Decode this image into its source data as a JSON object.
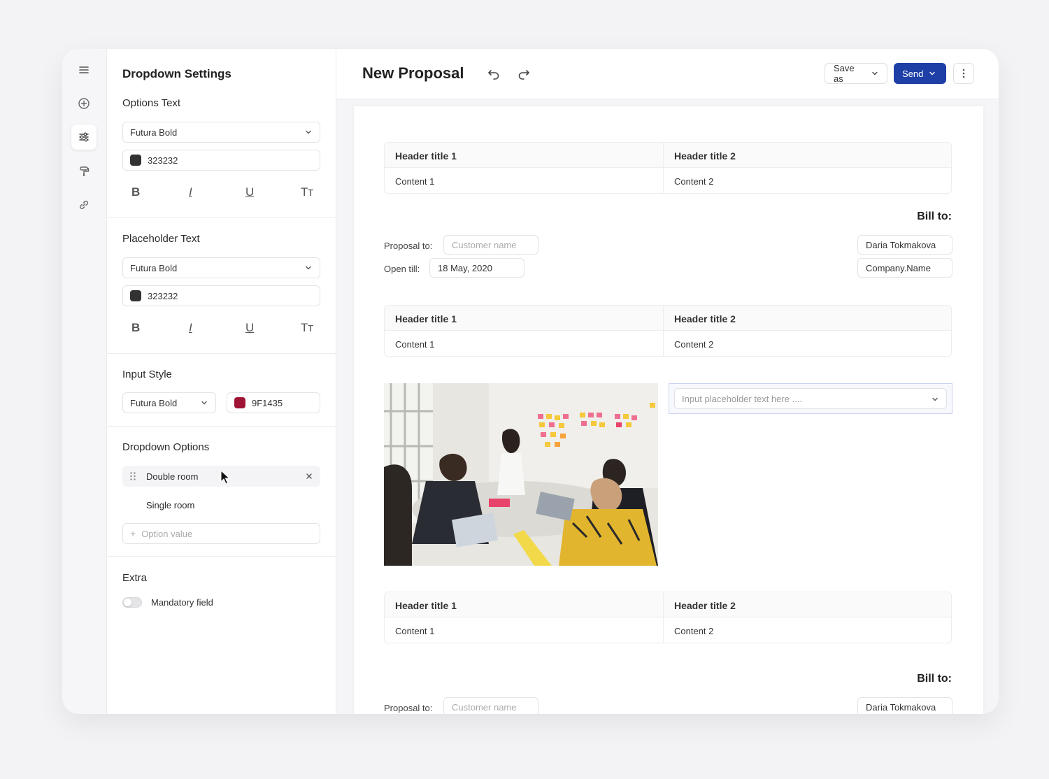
{
  "panel": {
    "title": "Dropdown Settings",
    "options_text": {
      "title": "Options Text",
      "font": "Futura Bold",
      "color_value": "323232",
      "color": "#323232"
    },
    "placeholder_text": {
      "title": "Placeholder Text",
      "font": "Futura Bold",
      "color_value": "323232",
      "color": "#323232"
    },
    "format_buttons": [
      "B",
      "I",
      "U",
      "Tт"
    ],
    "input_style": {
      "title": "Input Style",
      "font": "Futura Bold",
      "color_value": "9F1435",
      "color": "#9F1435"
    },
    "dropdown_options": {
      "title": "Dropdown Options",
      "items": [
        "Double room",
        "Single room"
      ],
      "new_placeholder": "Option value"
    },
    "extra": {
      "title": "Extra",
      "mandatory_label": "Mandatory field",
      "mandatory_on": false
    }
  },
  "header": {
    "title": "New Proposal",
    "save_as": "Save as",
    "send": "Send",
    "accent": "#1d3fa6"
  },
  "tables": [
    {
      "h1": "Header title 1",
      "h2": "Header title 2",
      "c1": "Content 1",
      "c2": "Content 2"
    },
    {
      "h1": "Header title 1",
      "h2": "Header title 2",
      "c1": "Content 1",
      "c2": "Content 2"
    },
    {
      "h1": "Header title 1",
      "h2": "Header title 2",
      "c1": "Content 1",
      "c2": "Content 2"
    }
  ],
  "bill": {
    "label": "Bill to:",
    "proposal_to_label": "Proposal to:",
    "customer_placeholder": "Customer name",
    "open_till_label": "Open till:",
    "open_till_value": "18 May, 2020",
    "contact_name": "Daria Tokmakova",
    "company": "Company.Name"
  },
  "dropdown_field": {
    "placeholder": "Input placeholder text here ...."
  }
}
